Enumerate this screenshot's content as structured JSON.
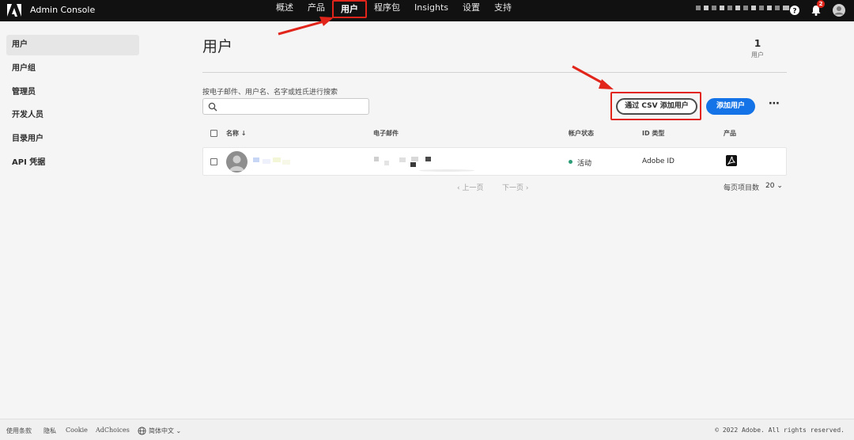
{
  "app": {
    "title": "Admin Console"
  },
  "nav": {
    "items": [
      "概述",
      "产品",
      "用户",
      "程序包",
      "Insights",
      "设置",
      "支持"
    ],
    "active_index": 2
  },
  "notifications": {
    "count": "2"
  },
  "sidebar": {
    "items": [
      "用户",
      "用户组",
      "管理员",
      "开发人员",
      "目录用户",
      "API 凭据"
    ],
    "active_index": 0
  },
  "main": {
    "title": "用户",
    "count_value": "1",
    "count_label": "用户",
    "search_label": "按电子邮件、用户名、名字或姓氏进行搜索",
    "search_value": "",
    "csv_button": "通过 CSV 添加用户",
    "add_button": "添加用户",
    "more_label": "⋯"
  },
  "table": {
    "headers": {
      "name": "名称 ↓",
      "email": "电子邮件",
      "status": "帐户状态",
      "id_type": "ID 类型",
      "products": "产品"
    },
    "rows": [
      {
        "status": "活动",
        "id_type": "Adobe ID",
        "product_icon": "acrobat-pdf-icon"
      }
    ]
  },
  "pagination": {
    "prev": "‹ 上一页",
    "next": "下一页 ›",
    "per_page_label": "每页项目数",
    "per_page_value": "20 ⌄"
  },
  "footer": {
    "terms": "使用条款",
    "privacy": "隐私",
    "cookie": "Cookie",
    "adchoices": "AdChoices",
    "language": "简体中文 ⌄",
    "copyright": "© 2022 Adobe. All rights reserved."
  },
  "colors": {
    "topbar": "#111111",
    "accent_blue": "#1473e6",
    "highlight_red": "#e1251b",
    "status_green": "#2d9d78"
  }
}
